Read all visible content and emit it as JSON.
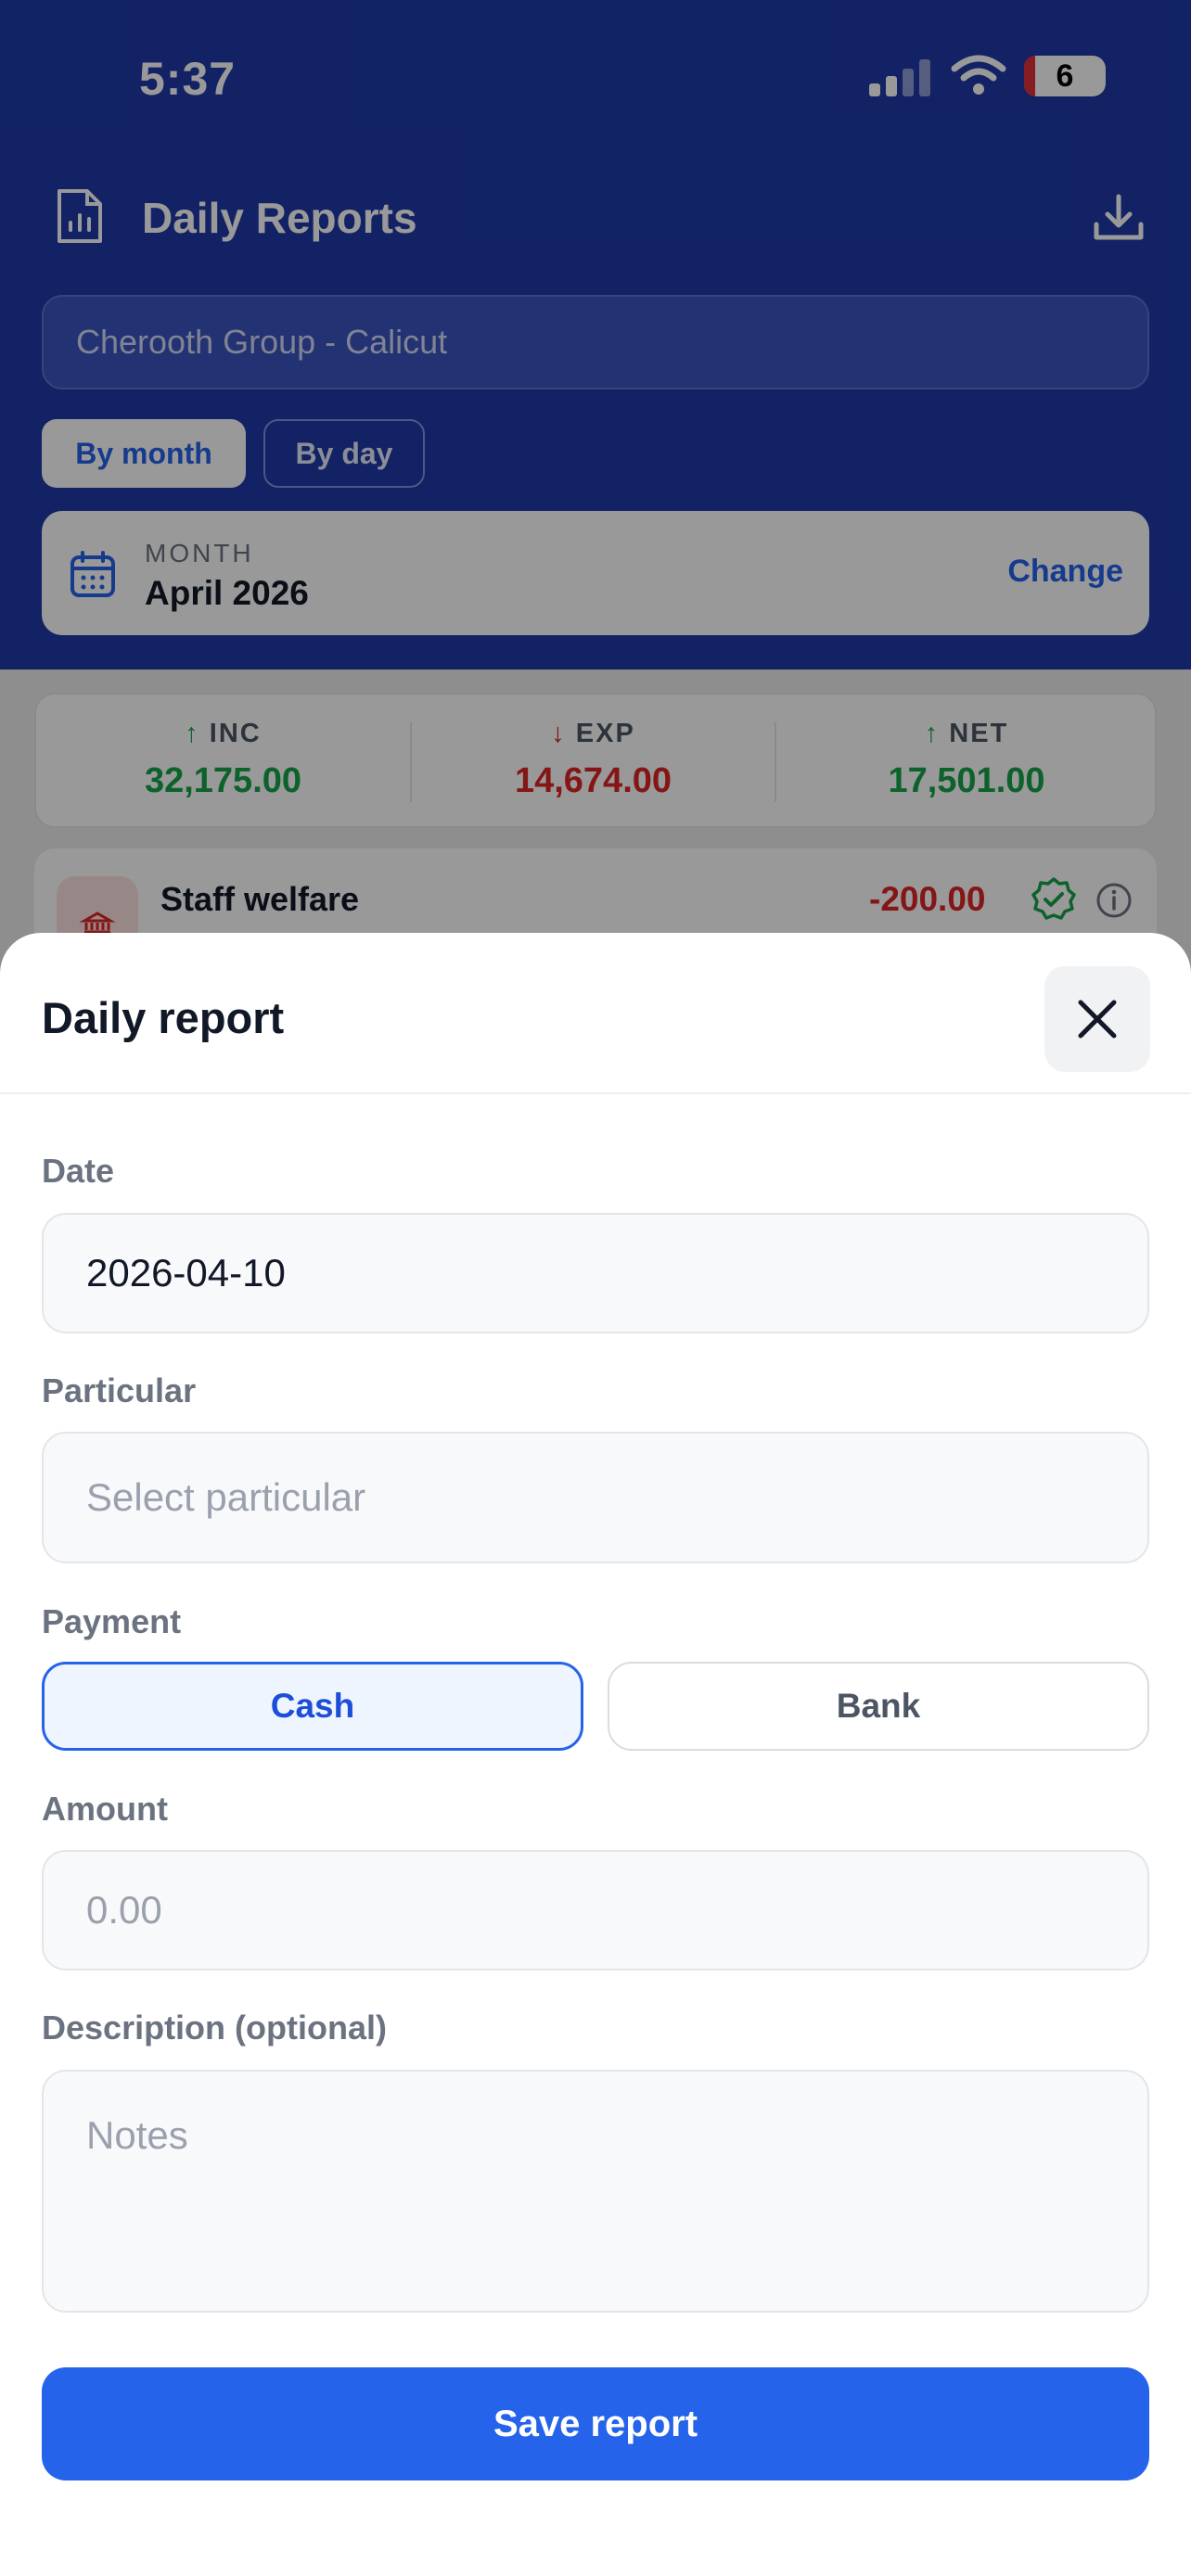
{
  "status_bar": {
    "time": "5:37",
    "battery": "6"
  },
  "header": {
    "title": "Daily Reports",
    "company": "Cherooth Group  - Calicut",
    "modes": [
      "By month",
      "By day"
    ],
    "month_label": "MONTH",
    "month_value": "April 2026",
    "change_label": "Change"
  },
  "summary": {
    "income": {
      "label": "INC",
      "value": "32,175.00"
    },
    "expense": {
      "label": "EXP",
      "value": "14,674.00"
    },
    "net": {
      "label": "NET",
      "value": "17,501.00"
    }
  },
  "entries": [
    {
      "title": "Staff welfare",
      "amount": "-200.00"
    }
  ],
  "sheet": {
    "title": "Daily report",
    "date_label": "Date",
    "date_value": "2026-04-10",
    "particular_label": "Particular",
    "particular_placeholder": "Select particular",
    "payment_label": "Payment",
    "payment_options": [
      "Cash",
      "Bank"
    ],
    "payment_selected": "Cash",
    "amount_label": "Amount",
    "amount_placeholder": "0.00",
    "description_label": "Description (optional)",
    "description_placeholder": "Notes",
    "save_label": "Save report"
  },
  "colors": {
    "header_bg": "#1e3aa8",
    "accent": "#2563eb",
    "income": "#16a34a",
    "expense": "#dc2626"
  }
}
